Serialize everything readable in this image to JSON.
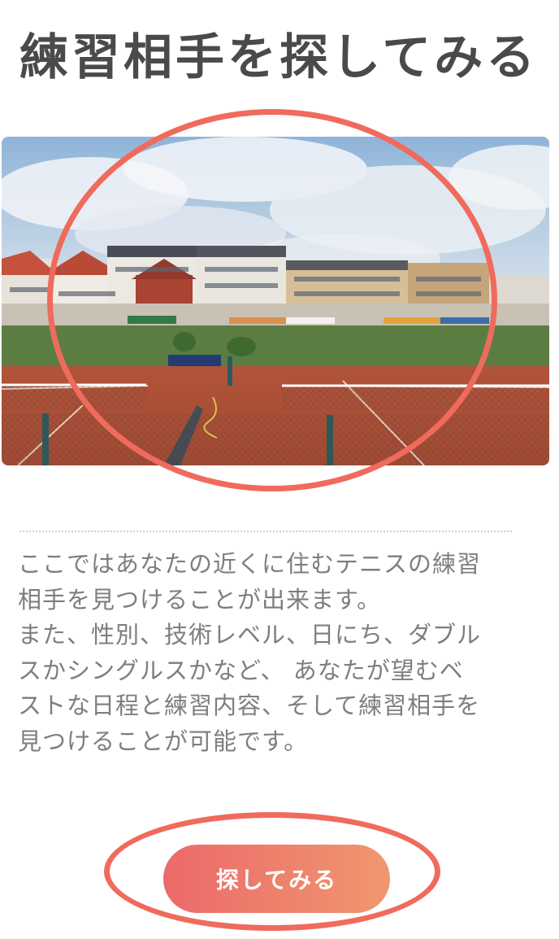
{
  "header": {
    "title": "練習相手を探してみる"
  },
  "photo": {
    "alt": "tennis-court-photo"
  },
  "description": {
    "lines": [
      "ここではあなたの近くに住むテニスの練習",
      "相手を見つけることが出来ます。",
      "また、性別、技術レベル、日にち、ダブル",
      "スかシングルスかなど、 あなたが望むベ",
      "ストな日程と練習内容、そして練習相手を",
      "見つけることが可能です。"
    ]
  },
  "cta": {
    "label": "探してみる"
  },
  "colors": {
    "title": "#4a4a4a",
    "body_text": "#7e7e7e",
    "highlight": "#ef6b5d",
    "button_gradient_start": "#eb6a6a",
    "button_gradient_end": "#f0976f"
  }
}
